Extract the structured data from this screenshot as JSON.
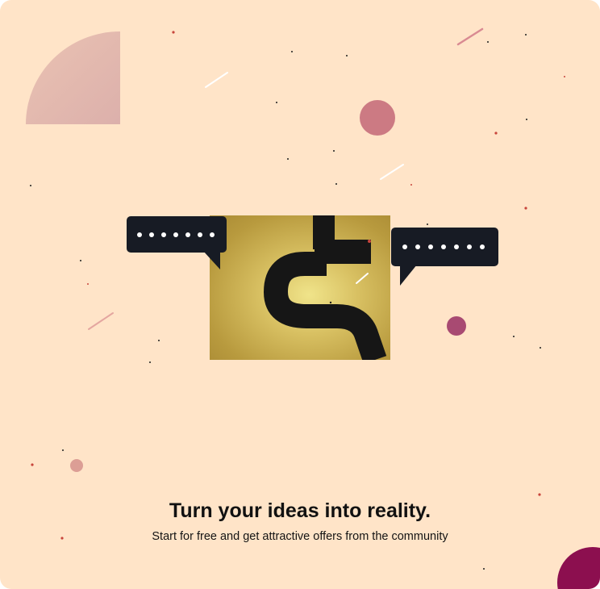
{
  "hero": {
    "headline": "Turn your ideas into reality.",
    "subline": "Start for free and get attractive offers from the community"
  },
  "illustration": {
    "logo_icon": "dollar-hook-icon",
    "left_bubble_dots": 7,
    "right_bubble_dots": 7
  },
  "colors": {
    "background": "#ffe4c8",
    "bubble": "#171b24",
    "accent_plum": "#8c0f4f",
    "accent_rose": "#c97480",
    "accent_mauve": "#a84a72",
    "gold": "#d8c062"
  }
}
